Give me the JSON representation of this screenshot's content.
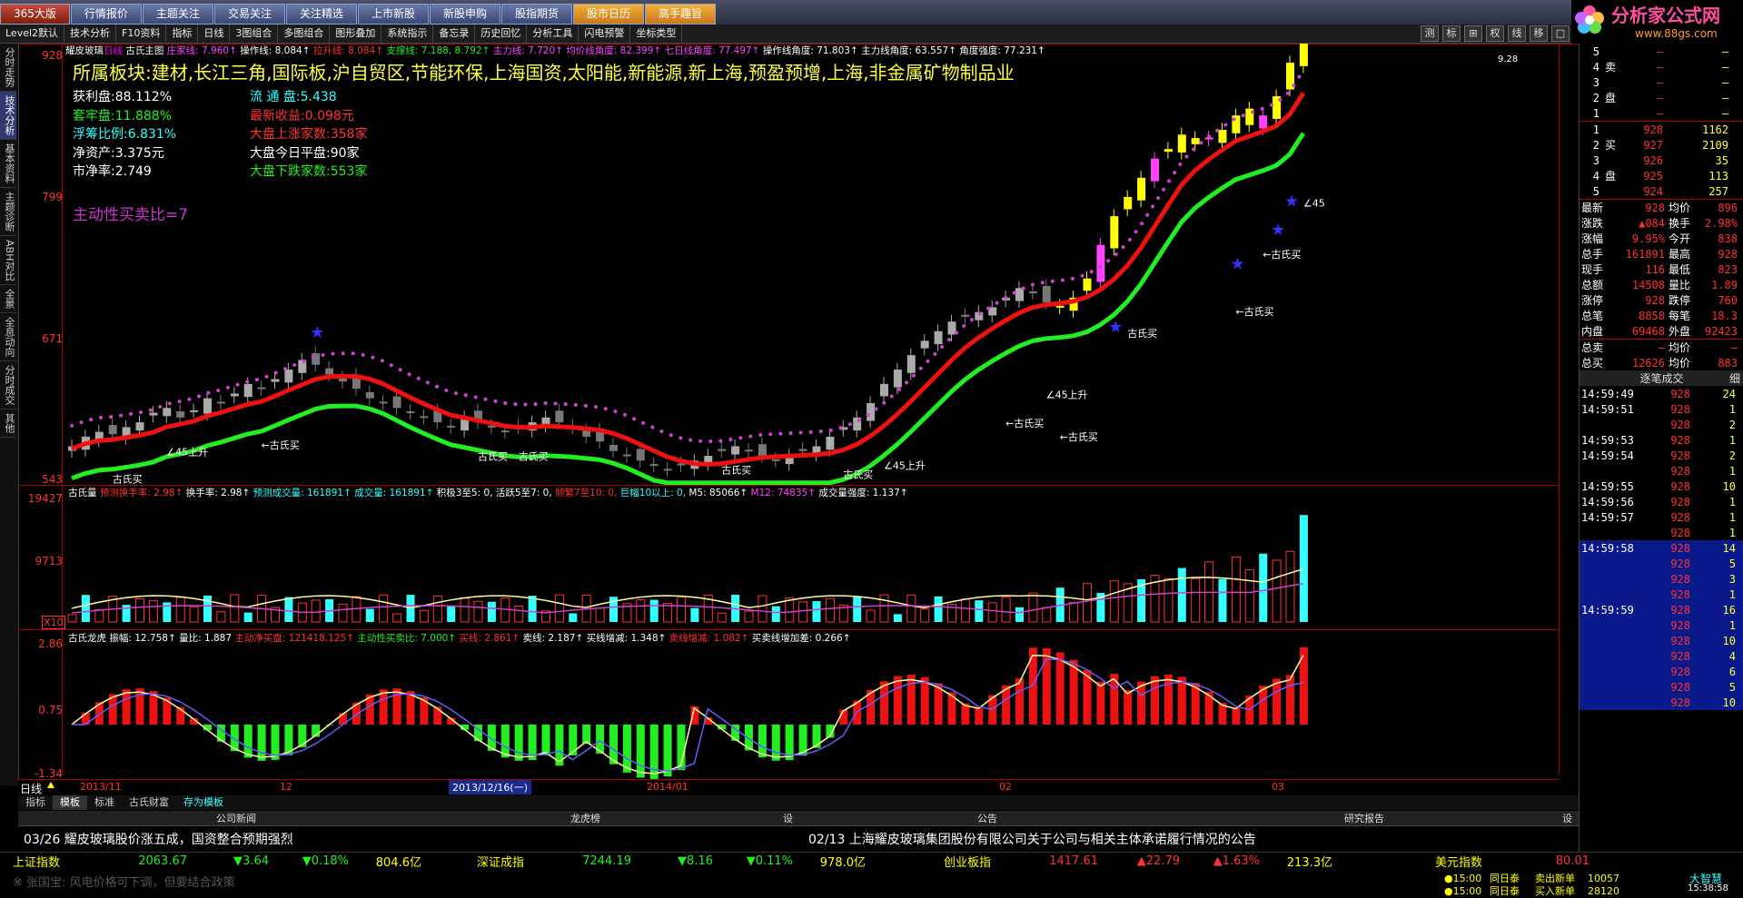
{
  "menu": {
    "tabs": [
      "365大版",
      "行情报价",
      "主题关注",
      "交易关注",
      "关注精选",
      "上市新股",
      "新股申购",
      "股指期货",
      "股市日历",
      "高手趣旨"
    ],
    "active": 0,
    "orange": [
      8,
      9
    ]
  },
  "toolbar": {
    "items": [
      "Level2默认",
      "技术分析",
      "F10资料",
      "指标",
      "日线",
      "3图组合",
      "多图组合",
      "图形叠加",
      "系统指示",
      "备忘录",
      "历史回忆",
      "分析工具",
      "闪电预警",
      "坐标类型"
    ],
    "right_icons": [
      "测",
      "标",
      "⊞",
      "权",
      "线",
      "移",
      "□"
    ]
  },
  "logo": {
    "text": "分析家公式网",
    "url": "www.88gs.com"
  },
  "left_tabs": [
    "分时走势",
    "技术分析",
    "基本资料",
    "主题诊断",
    "ABH对比",
    "全景",
    "全息动向",
    "分时成交",
    "其他"
  ],
  "left_active": 1,
  "main_chart": {
    "title_line": [
      {
        "t": "耀皮玻璃",
        "c": "#fff"
      },
      {
        "t": "日线",
        "c": "#f0f"
      },
      {
        "t": " 古氏主图",
        "c": "#fff"
      },
      {
        "t": " 庄家线: 7.960↑",
        "c": "#f4f"
      },
      {
        "t": " 操作线: 8.084↑",
        "c": "#fff"
      },
      {
        "t": " 拉升线: 8.084↑",
        "c": "#f33"
      },
      {
        "t": " 支撑线: 7.188, 8.792↑",
        "c": "#2e2"
      },
      {
        "t": " 主力线: 7.720↑",
        "c": "#f4f"
      },
      {
        "t": " 均价线角度: 82.399↑",
        "c": "#f4f"
      },
      {
        "t": " 七日线角度: 77.497↑",
        "c": "#f4f"
      },
      {
        "t": " 操作线角度: 71.803↑",
        "c": "#fff"
      },
      {
        "t": " 主力线角度: 63.557↑",
        "c": "#fff"
      },
      {
        "t": " 角度强度: 77.231↑",
        "c": "#fff"
      }
    ],
    "sectors": "所属板块:建材,长江三角,国际板,沪自贸区,节能环保,上海国资,太阳能,新能源,新上海,预盈预增,上海,非金属矿物制品业",
    "info_left": [
      {
        "t": "获利盘:88.112%",
        "c": "#fff"
      },
      {
        "t": "套牢盘:11.888%",
        "c": "#2e2"
      },
      {
        "t": "浮筹比例:6.831%",
        "c": "#3ff"
      },
      {
        "t": "净资产:3.375元",
        "c": "#fff"
      },
      {
        "t": "市净率:2.749",
        "c": "#fff"
      }
    ],
    "info_right": [
      {
        "t": "流 通 盘:5.438",
        "c": "#3ff"
      },
      {
        "t": "最新收益:0.098元",
        "c": "#f33"
      },
      {
        "t": "大盘上涨家数:358家",
        "c": "#f33"
      },
      {
        "t": "大盘今日平盘:90家",
        "c": "#fff"
      },
      {
        "t": "大盘下跌家数:553家",
        "c": "#2e2"
      }
    ],
    "buy_sell_ratio": "主动性买卖比=7",
    "y_labels": [
      "928",
      "799",
      "671",
      "543"
    ],
    "peak_label": "9.28",
    "annotations": [
      "古氏买",
      "∠45上升",
      "←古氏买",
      "古氏买",
      "古氏买",
      "古氏买",
      "∠45上升",
      "古氏买",
      "←古氏买",
      "←古氏买",
      "∠45上升",
      "古氏买",
      "←古氏买",
      "←古氏买",
      "∠45"
    ]
  },
  "vol_panel": {
    "title_line": [
      {
        "t": "古氏量",
        "c": "#fff"
      },
      {
        "t": " 预测换手率: 2.98↑",
        "c": "#f33"
      },
      {
        "t": " 换手率: 2.98↑",
        "c": "#fff"
      },
      {
        "t": " 预测成交量: 161891↑",
        "c": "#3ff"
      },
      {
        "t": " 成交量: 161891↑",
        "c": "#3ff"
      },
      {
        "t": " 积极3至5: 0,",
        "c": "#fff"
      },
      {
        "t": " 活跃5至7: 0,",
        "c": "#fff"
      },
      {
        "t": " 频繁7至10: 0,",
        "c": "#f33"
      },
      {
        "t": " 巨幅10以上: 0,",
        "c": "#3ff"
      },
      {
        "t": " M5: 85066↑",
        "c": "#fff"
      },
      {
        "t": " M12: 74835↑",
        "c": "#f4f"
      },
      {
        "t": " 成交量强度: 1.137↑",
        "c": "#fff"
      }
    ],
    "y_labels": [
      "19427",
      "9713"
    ],
    "unit": "X10"
  },
  "dragon_panel": {
    "title_line": [
      {
        "t": "古氏龙虎",
        "c": "#fff"
      },
      {
        "t": " 振幅: 12.758↑",
        "c": "#fff"
      },
      {
        "t": " 量比: 1.887",
        "c": "#fff"
      },
      {
        "t": " 主动净买盘: 121418.125↑",
        "c": "#f33"
      },
      {
        "t": " 主动性买卖比: 7.000↑",
        "c": "#2e2"
      },
      {
        "t": " 买线: 2.861↑",
        "c": "#f33"
      },
      {
        "t": " 卖线: 2.187↑",
        "c": "#fff"
      },
      {
        "t": " 买线增减: 1.348↑",
        "c": "#fff"
      },
      {
        "t": " 卖线增减: 1.082↑",
        "c": "#f33"
      },
      {
        "t": " 买卖线增加差: 0.266↑",
        "c": "#fff"
      }
    ],
    "y_labels": [
      "2.86",
      "0.75",
      "-1.34"
    ]
  },
  "date_axis": [
    "2013/11",
    "12",
    "2013/12/16(一)",
    "2014/01",
    "02",
    "03"
  ],
  "period_label": "日线",
  "bottom_tabs": [
    "指标",
    "模板",
    "标准",
    "古氏财富",
    "存为模板"
  ],
  "news": {
    "headers": [
      "公司新闻",
      "龙虎榜",
      "设",
      "公告",
      "研究报告",
      "设"
    ],
    "left": "03/26  耀皮玻璃股价涨五成，国资整合预期强烈",
    "right": "02/13  上海耀皮玻璃集团股份有限公司关于公司与相关主体承诺履行情况的公告"
  },
  "right_panel": {
    "top_number": "5",
    "sell_label": [
      "卖",
      "盘"
    ],
    "sell_rows": [
      {
        "n": "4",
        "p": "—",
        "v": "—"
      },
      {
        "n": "3",
        "p": "—",
        "v": "—"
      },
      {
        "n": "2",
        "p": "—",
        "v": "—"
      },
      {
        "n": "1",
        "p": "—",
        "v": "—"
      }
    ],
    "buy_label": [
      "买",
      "盘"
    ],
    "buy_rows": [
      {
        "n": "1",
        "p": "928",
        "v": "1162"
      },
      {
        "n": "2",
        "p": "927",
        "v": "2109"
      },
      {
        "n": "3",
        "p": "926",
        "v": "35"
      },
      {
        "n": "4",
        "p": "925",
        "v": "113"
      },
      {
        "n": "5",
        "p": "924",
        "v": "257"
      }
    ],
    "stats": [
      {
        "l": "最新",
        "v": "928",
        "l2": "均价",
        "v2": "896"
      },
      {
        "l": "涨跌",
        "v": "▲084",
        "l2": "换手",
        "v2": "2.98%"
      },
      {
        "l": "涨幅",
        "v": "9.95%",
        "l2": "今开",
        "v2": "838"
      },
      {
        "l": "总手",
        "v": "161891",
        "l2": "最高",
        "v2": "928"
      },
      {
        "l": "现手",
        "v": "116",
        "l2": "最低",
        "v2": "823"
      },
      {
        "l": "总额",
        "v": "14508",
        "l2": "量比",
        "v2": "1.89"
      },
      {
        "l": "涨停",
        "v": "928",
        "l2": "跌停",
        "v2": "760"
      },
      {
        "l": "总笔",
        "v": "8858",
        "l2": "每笔",
        "v2": "18.3"
      },
      {
        "l": "内盘",
        "v": "69468",
        "l2": "外盘",
        "v2": "92423"
      }
    ],
    "sell_total": {
      "l": "总卖",
      "v": "—",
      "l2": "均价",
      "v2": "—"
    },
    "buy_total": {
      "l": "总买",
      "v": "12626",
      "l2": "均价",
      "v2": "883"
    },
    "ticks_header": "逐笔成交",
    "ticks_header_right": "细",
    "ticks": [
      {
        "t": "14:59:49",
        "p": "928",
        "v": "24"
      },
      {
        "t": "14:59:51",
        "p": "928",
        "v": "1"
      },
      {
        "t": "",
        "p": "928",
        "v": "2"
      },
      {
        "t": "14:59:53",
        "p": "928",
        "v": "1"
      },
      {
        "t": "14:59:54",
        "p": "928",
        "v": "2"
      },
      {
        "t": "",
        "p": "928",
        "v": "1"
      },
      {
        "t": "14:59:55",
        "p": "928",
        "v": "10"
      },
      {
        "t": "14:59:56",
        "p": "928",
        "v": "1"
      },
      {
        "t": "14:59:57",
        "p": "928",
        "v": "1"
      },
      {
        "t": "",
        "p": "928",
        "v": "1"
      },
      {
        "t": "14:59:58",
        "p": "928",
        "v": "14"
      },
      {
        "t": "",
        "p": "928",
        "v": "5"
      },
      {
        "t": "",
        "p": "928",
        "v": "3"
      },
      {
        "t": "",
        "p": "928",
        "v": "1"
      },
      {
        "t": "14:59:59",
        "p": "928",
        "v": "16"
      },
      {
        "t": "",
        "p": "928",
        "v": "1"
      },
      {
        "t": "",
        "p": "928",
        "v": "10"
      },
      {
        "t": "",
        "p": "928",
        "v": "4"
      },
      {
        "t": "",
        "p": "928",
        "v": "6"
      },
      {
        "t": "",
        "p": "928",
        "v": "5"
      },
      {
        "t": "",
        "p": "928",
        "v": "10"
      }
    ],
    "bottom_tabs": [
      "分笔",
      "逐笔",
      "财务",
      "分价",
      "成本"
    ]
  },
  "status": {
    "indices": [
      {
        "name": "上证指数",
        "val": "2063.67",
        "chg": "▼3.64",
        "pct": "▼0.18%",
        "amt": "804.6亿"
      },
      {
        "name": "深证成指",
        "val": "7244.19",
        "chg": "▼8.16",
        "pct": "▼0.11%",
        "amt": "978.0亿"
      },
      {
        "name": "创业板指",
        "val": "1417.61",
        "chg": "▲22.79",
        "pct": "▲1.63%",
        "amt": "213.3亿"
      },
      {
        "name": "美元指数",
        "val": "80.01",
        "chg": "",
        "pct": "",
        "amt": ""
      }
    ],
    "ticker": "※ 张国宝: 风电价格可下调，但要结合政策",
    "alerts": [
      {
        "time": "15:00",
        "name": "同日泰",
        "act": "卖出新单",
        "num": "10057"
      },
      {
        "time": "15:00",
        "name": "同日泰",
        "act": "买入新单",
        "num": "28120"
      }
    ],
    "brand": "大智慧",
    "clock": "15:38:58"
  }
}
